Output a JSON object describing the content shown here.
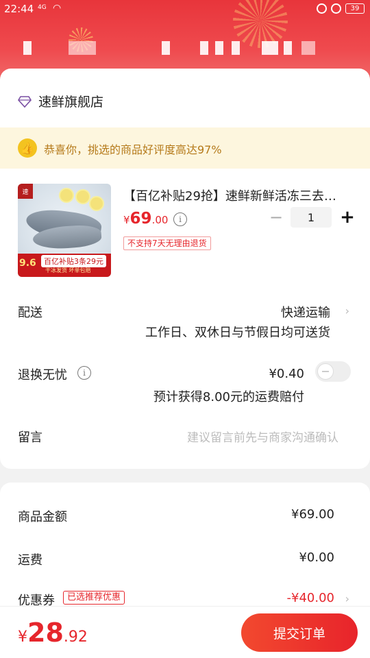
{
  "status_bar": {
    "time": "22:44",
    "signal": "4G",
    "battery": "39"
  },
  "store": {
    "name": "速鲜旗舰店"
  },
  "banner": {
    "text": "恭喜你，挑选的商品好评度高达97%"
  },
  "product": {
    "title": "【百亿补贴29抢】速鲜新鲜活冻三去…",
    "price_currency": "¥",
    "price_int": "69",
    "price_dec": ".00",
    "return_tag": "不支持7天无理由退货",
    "quantity": "1",
    "image_promo": "百亿补贴3条29元",
    "image_sub": "干冰发货 坏单包赔",
    "image_num": "9.6"
  },
  "delivery": {
    "label": "配送",
    "method": "快递运输",
    "note": "工作日、双休日与节假日均可送货"
  },
  "return_insurance": {
    "label": "退换无忧",
    "price": "¥0.40",
    "note": "预计获得8.00元的运费赔付",
    "enabled": false
  },
  "message": {
    "label": "留言",
    "placeholder": "建议留言前先与商家沟通确认"
  },
  "summary": {
    "goods_label": "商品金额",
    "goods_value": "¥69.00",
    "shipping_label": "运费",
    "shipping_value": "¥0.00",
    "coupon_label": "优惠券",
    "coupon_tag": "已选推荐优惠",
    "coupon_value": "-¥40.00"
  },
  "footer": {
    "total_currency": "¥",
    "total_int": "28",
    "total_dec": ".92",
    "submit_label": "提交订单"
  },
  "colors": {
    "accent": "#e6262c",
    "banner_bg": "#fdf6de",
    "banner_text": "#b57a1a"
  }
}
